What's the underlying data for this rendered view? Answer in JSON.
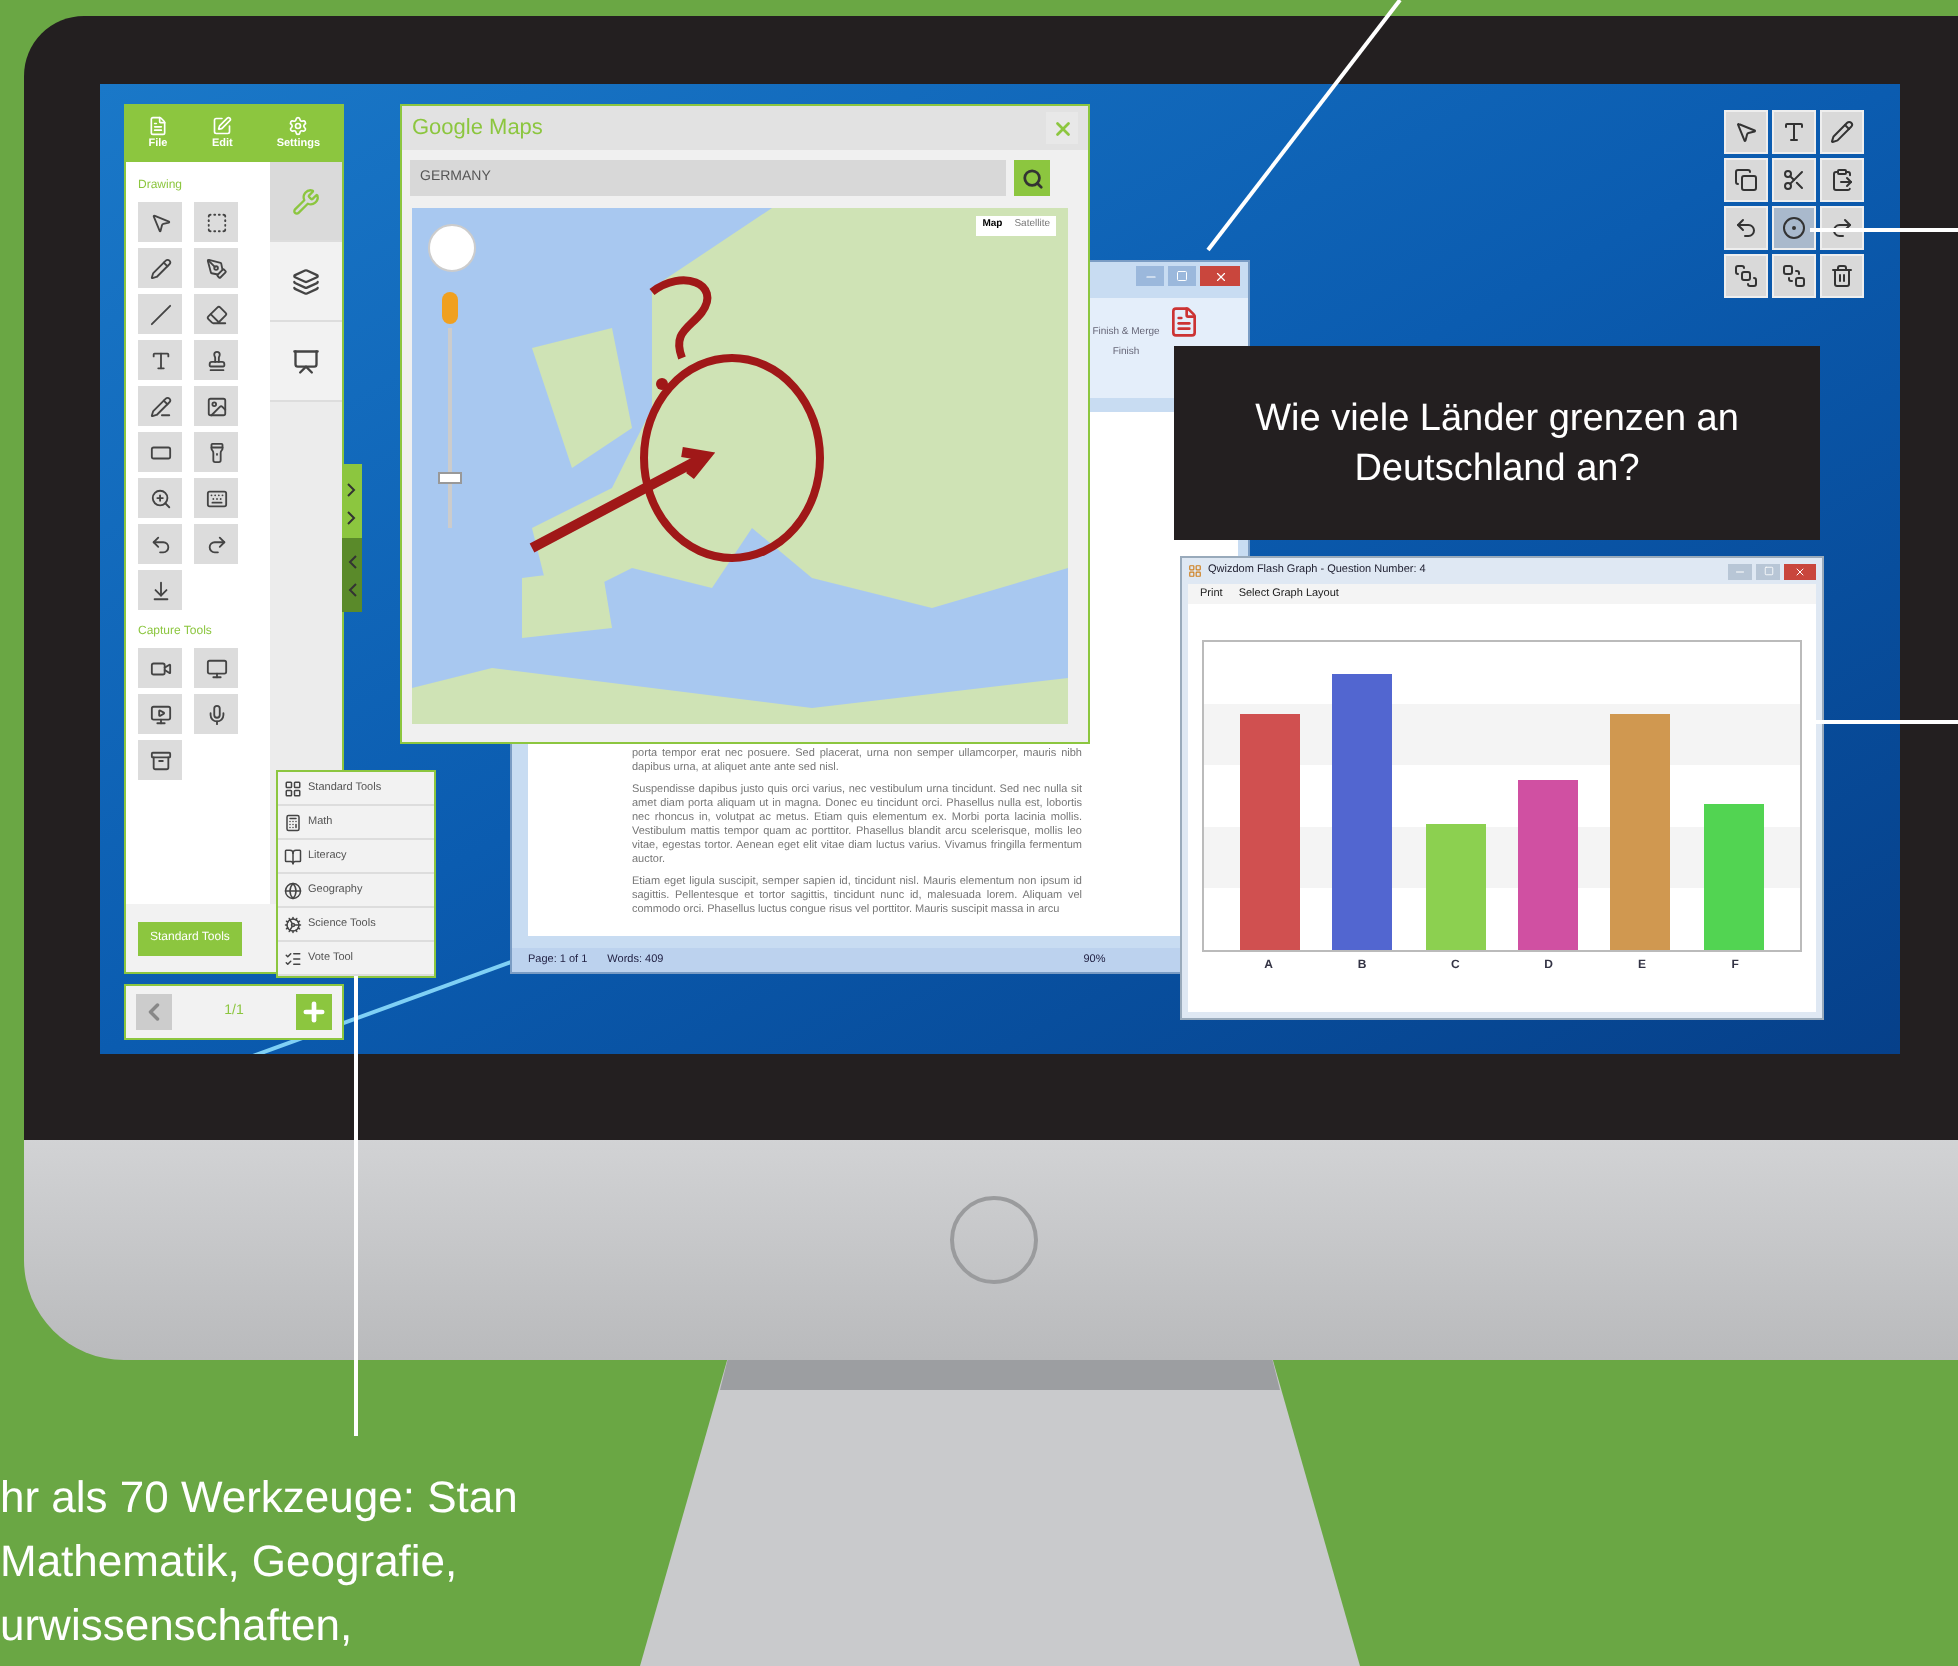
{
  "tool_panel": {
    "menu": [
      {
        "label": "File"
      },
      {
        "label": "Edit"
      },
      {
        "label": "Settings"
      }
    ],
    "sections": [
      {
        "title": "Drawing"
      },
      {
        "title": "Capture Tools"
      }
    ],
    "side_tabs": [
      {
        "selected": true
      },
      {
        "selected": false
      },
      {
        "selected": false
      }
    ],
    "toolset_button": "Standard Tools"
  },
  "page_nav": {
    "page": "1/1"
  },
  "toolset_menu": [
    {
      "label": "Standard Tools"
    },
    {
      "label": "Math"
    },
    {
      "label": "Literacy"
    },
    {
      "label": "Geography"
    },
    {
      "label": "Science Tools"
    },
    {
      "label": "Vote Tool"
    }
  ],
  "maps_window": {
    "title": "Google Maps",
    "search_value": "GERMANY",
    "zoom_slider": {
      "level": 0.25
    },
    "map_types": [
      {
        "label": "Map",
        "selected": true
      },
      {
        "label": "Satellite",
        "selected": false
      }
    ]
  },
  "word_window": {
    "ribbon_button": "Finish & Merge",
    "ribbon_group": "Finish",
    "paragraphs": [
      "porta tempor erat nec posuere. Sed placerat, urna non semper ullamcorper, mauris nibh dapibus urna, at aliquet ante ante sed nisl.",
      "Suspendisse dapibus justo quis orci varius, nec vestibulum urna tincidunt. Sed nec nulla sit amet diam porta aliquam ut in magna. Donec eu tincidunt orci. Phasellus nulla est, lobortis nec rhoncus in, volutpat ac metus. Etiam quis elementum ex. Morbi porta lacinia mollis. Vestibulum mattis tempor quam ac porttitor. Phasellus blandit arcu scelerisque, mollis leo vitae, egestas tortor. Aenean eget elit vitae diam luctus varius. Vivamus fringilla fermentum auctor.",
      "Etiam eget ligula suscipit, semper sapien id, tincidunt nisl. Mauris elementum non ipsum id sagittis. Pellentesque et tortor sagittis, tincidunt nunc id, malesuada lorem. Aliquam vel commodo orci. Phasellus luctus congue risus vel porttitor. Mauris suscipit massa in arcu"
    ],
    "status": {
      "page": "Page: 1 of 1",
      "words": "Words: 409",
      "zoom": "90%"
    }
  },
  "floating_toolbar": [
    {
      "selected": false
    },
    {
      "selected": false
    },
    {
      "selected": false
    },
    {
      "selected": false
    },
    {
      "selected": false
    },
    {
      "selected": false
    },
    {
      "selected": false
    },
    {
      "selected": true
    },
    {
      "selected": false
    },
    {
      "selected": false
    },
    {
      "selected": false
    },
    {
      "selected": false
    }
  ],
  "question": "Wie viele Länder grenzen an Deutschland an?",
  "graph_window": {
    "title": "Qwizdom Flash Graph - Question Number: 4",
    "menu": [
      "Print",
      "Select Graph Layout"
    ],
    "bars": [
      {
        "label": "A",
        "color": "#d05050"
      },
      {
        "label": "B",
        "color": "#5266d0"
      },
      {
        "label": "C",
        "color": "#8cd050"
      },
      {
        "label": "D",
        "color": "#d050a2"
      },
      {
        "label": "E",
        "color": "#d09850"
      },
      {
        "label": "F",
        "color": "#52d452"
      }
    ]
  },
  "caption": [
    "hr als 70 Werkzeuge: Stan",
    "Mathematik, Geografie,",
    "urwissenschaften,"
  ]
}
